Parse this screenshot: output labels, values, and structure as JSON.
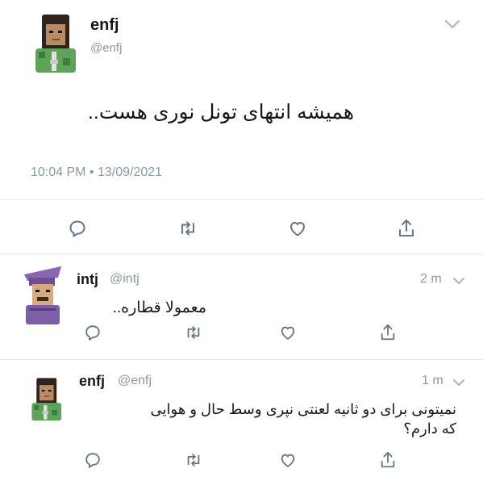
{
  "main_tweet": {
    "name": "enfj",
    "handle": "@enfj",
    "text": "همیشه انتهای تونل نوری هست..",
    "timestamp": "10:04 PM • 13/09/2021",
    "icons": [
      "reply-icon",
      "retweet-icon",
      "like-icon",
      "share-icon",
      "chevron-down-icon"
    ]
  },
  "replies": [
    {
      "name": "intj",
      "handle": "@intj",
      "time": "2 m",
      "text": "معمولا قطاره.."
    },
    {
      "name": "enfj",
      "handle": "@enfj",
      "time": "1 m",
      "text_line1": "نمیتونی برای دو ثانیه لعنتی نپری وسط حال و هوایی",
      "text_line2": "که دارم؟"
    }
  ],
  "colors": {
    "text": "#14171a",
    "muted": "#8899a6",
    "divider": "#e1e8ed",
    "icon": "#657786"
  }
}
